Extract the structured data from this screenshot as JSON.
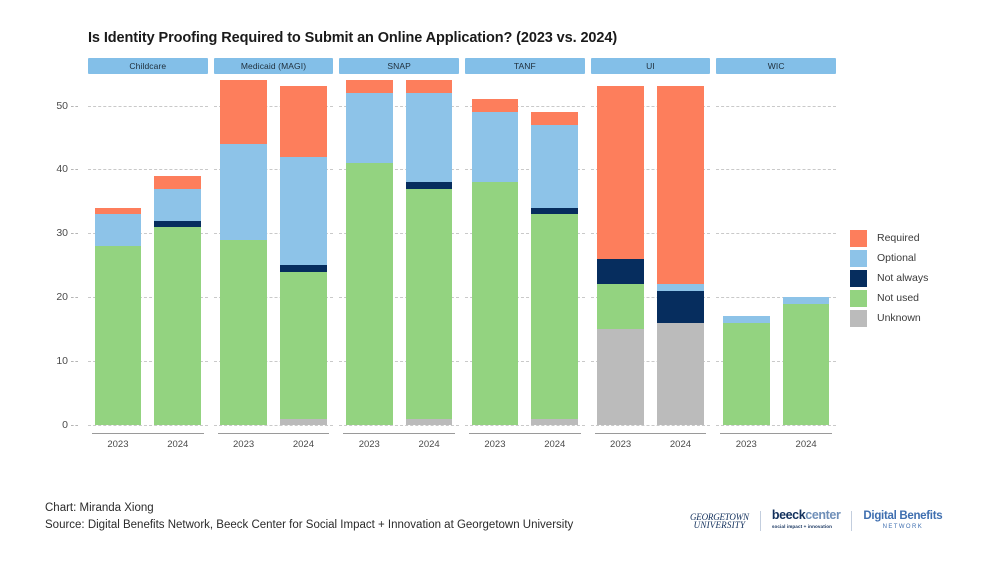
{
  "title": "Is Identity Proofing Required to Submit an Online Application? (2023 vs. 2024)",
  "footer": {
    "chart_credit": "Chart: Miranda Xiong",
    "source": "Source: Digital Benefits Network, Beeck Center for Social Impact + Innovation at Georgetown University"
  },
  "logos": {
    "georgetown_line1": "GEORGETOWN",
    "georgetown_line2": "UNIVERSITY",
    "beeck_bold": "beeck",
    "beeck_light": "center",
    "beeck_tagline": "social impact + innovation",
    "dbn_line1": "Digital Benefits",
    "dbn_line2": "NETWORK"
  },
  "legend": {
    "position": "right",
    "items": [
      {
        "label": "Required",
        "color": "#FD7E5C"
      },
      {
        "label": "Optional",
        "color": "#8DC3E8"
      },
      {
        "label": "Not always",
        "color": "#062D5E"
      },
      {
        "label": "Not used",
        "color": "#93D380"
      },
      {
        "label": "Unknown",
        "color": "#BBBBBB"
      }
    ]
  },
  "colors": {
    "required": "#FD7E5C",
    "optional": "#8DC3E8",
    "not_always": "#062D5E",
    "not_used": "#93D380",
    "unknown": "#BBBBBB",
    "facet_header": "#83bfe8",
    "gridline": "#c9c9c9"
  },
  "chart_data": {
    "type": "bar",
    "subtype": "stacked-bar-faceted",
    "title": "Is Identity Proofing Required to Submit an Online Application? (2023 vs. 2024)",
    "xlabel": "",
    "ylabel": "",
    "ylim": [
      0,
      54
    ],
    "yticks": [
      0,
      10,
      20,
      30,
      40,
      50
    ],
    "grid": true,
    "stack_order_bottom_to_top": [
      "Unknown",
      "Not used",
      "Not always",
      "Optional",
      "Required"
    ],
    "facets": [
      "Childcare",
      "Medicaid (MAGI)",
      "SNAP",
      "TANF",
      "UI",
      "WIC"
    ],
    "categories": [
      "2023",
      "2024"
    ],
    "series": [
      {
        "name": "Unknown",
        "color": "#BBBBBB",
        "values": {
          "Childcare": [
            0,
            0
          ],
          "Medicaid (MAGI)": [
            0,
            1
          ],
          "SNAP": [
            0,
            1
          ],
          "TANF": [
            0,
            1
          ],
          "UI": [
            15,
            16
          ],
          "WIC": [
            0,
            0
          ]
        }
      },
      {
        "name": "Not used",
        "color": "#93D380",
        "values": {
          "Childcare": [
            28,
            31
          ],
          "Medicaid (MAGI)": [
            29,
            23
          ],
          "SNAP": [
            41,
            36
          ],
          "TANF": [
            38,
            32
          ],
          "UI": [
            7,
            0
          ],
          "WIC": [
            16,
            19
          ]
        }
      },
      {
        "name": "Not always",
        "color": "#062D5E",
        "values": {
          "Childcare": [
            0,
            1
          ],
          "Medicaid (MAGI)": [
            0,
            1
          ],
          "SNAP": [
            0,
            1
          ],
          "TANF": [
            0,
            1
          ],
          "UI": [
            4,
            5
          ],
          "WIC": [
            0,
            0
          ]
        }
      },
      {
        "name": "Optional",
        "color": "#8DC3E8",
        "values": {
          "Childcare": [
            5,
            5
          ],
          "Medicaid (MAGI)": [
            15,
            17
          ],
          "SNAP": [
            11,
            14
          ],
          "TANF": [
            11,
            13
          ],
          "UI": [
            0,
            1
          ],
          "WIC": [
            1,
            1
          ]
        }
      },
      {
        "name": "Required",
        "color": "#FD7E5C",
        "values": {
          "Childcare": [
            1,
            2
          ],
          "Medicaid (MAGI)": [
            10,
            11
          ],
          "SNAP": [
            2,
            2
          ],
          "TANF": [
            2,
            2
          ],
          "UI": [
            27,
            31
          ],
          "WIC": [
            0,
            0
          ]
        }
      }
    ],
    "totals": {
      "Childcare": [
        34,
        39
      ],
      "Medicaid (MAGI)": [
        54,
        53
      ],
      "SNAP": [
        54,
        54
      ],
      "TANF": [
        51,
        49
      ],
      "UI": [
        53,
        53
      ],
      "WIC": [
        17,
        20
      ]
    }
  }
}
